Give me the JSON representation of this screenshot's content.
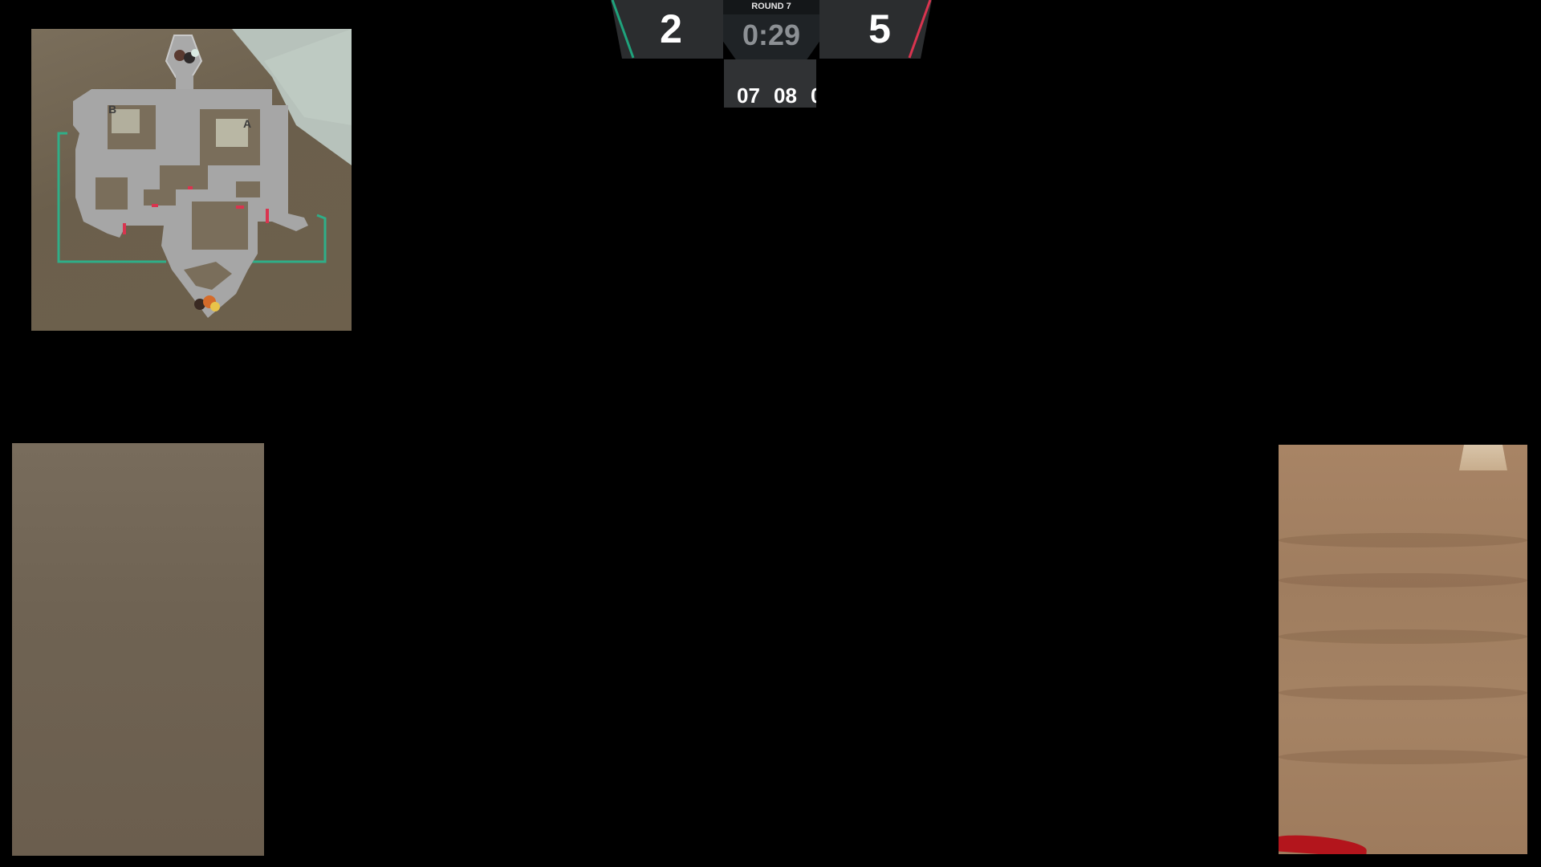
{
  "minimap": {
    "site_a": "A",
    "site_b": "B"
  },
  "scoreboard": {
    "round_label": "ROUND 7",
    "timer": "0:29",
    "score_left": "2",
    "score_right": "5",
    "left_color": "#1fa37c",
    "right_color": "#d9344f"
  },
  "economy": {
    "values": [
      "07",
      "08"
    ]
  },
  "feeds": {
    "left_icon": "camera-feed",
    "right_icon": "camera-feed"
  }
}
